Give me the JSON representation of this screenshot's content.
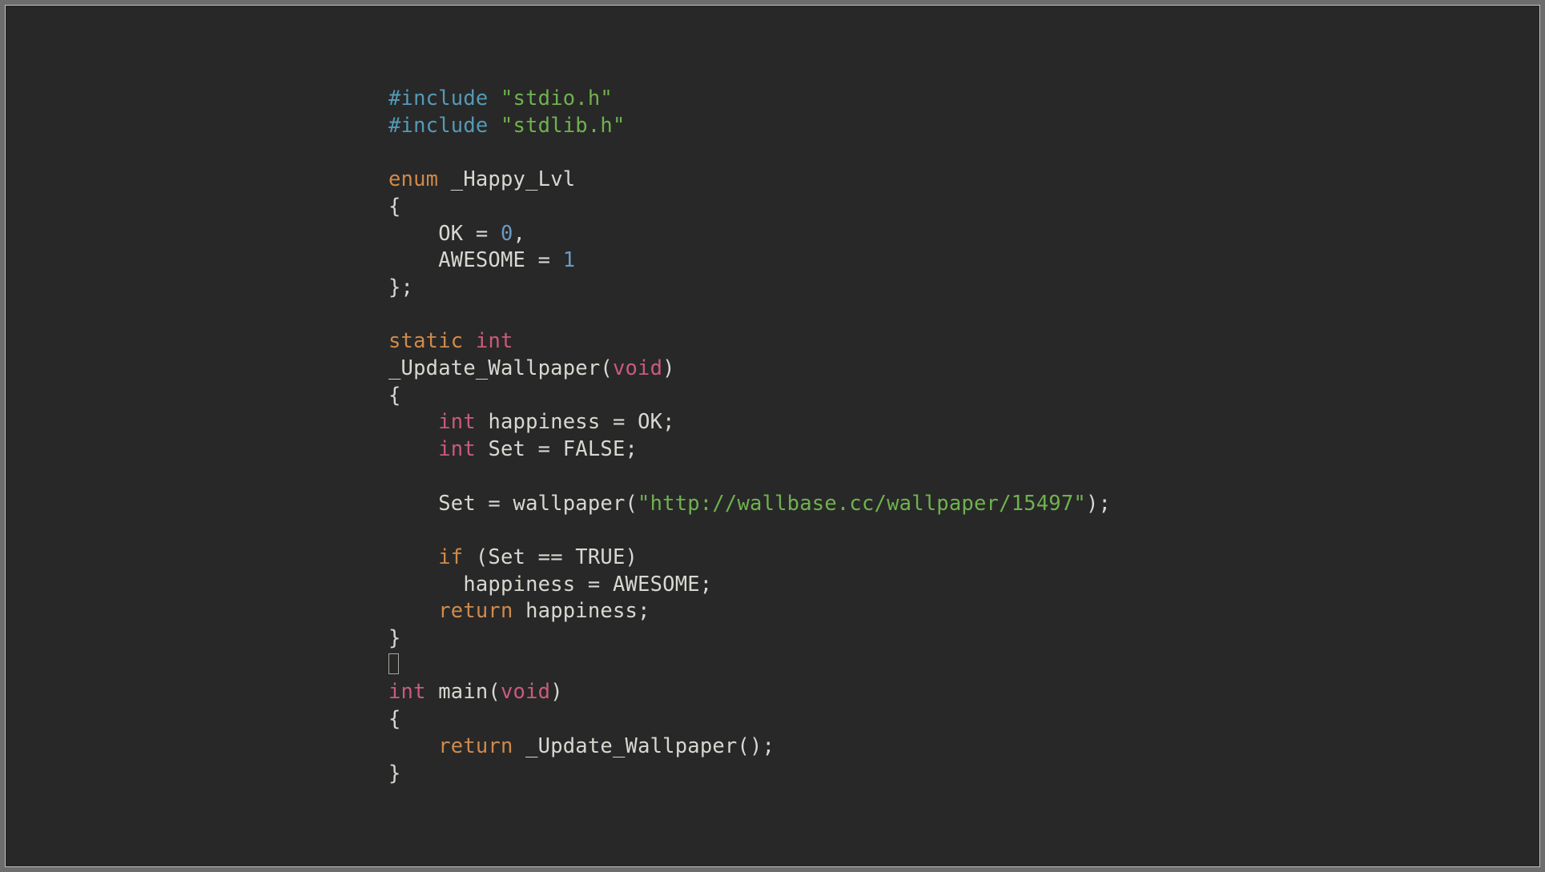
{
  "colors": {
    "background": "#282828",
    "frame_border": "#c0c0c0",
    "default_text": "#d8d8d2",
    "keyword": "#d08a4a",
    "preprocessor": "#549ab5",
    "string": "#6fb24e",
    "type": "#c95b7c",
    "number": "#6a9ac4"
  },
  "code": {
    "lines": [
      [
        {
          "class": "preproc",
          "text": "#include "
        },
        {
          "class": "string",
          "text": "\"stdio.h\""
        }
      ],
      [
        {
          "class": "preproc",
          "text": "#include "
        },
        {
          "class": "string",
          "text": "\"stdlib.h\""
        }
      ],
      [],
      [
        {
          "class": "keyword",
          "text": "enum"
        },
        {
          "class": "ident",
          "text": " _Happy_Lvl"
        }
      ],
      [
        {
          "class": "ident",
          "text": "{"
        }
      ],
      [
        {
          "class": "ident",
          "text": "    OK = "
        },
        {
          "class": "number",
          "text": "0"
        },
        {
          "class": "ident",
          "text": ","
        }
      ],
      [
        {
          "class": "ident",
          "text": "    AWESOME = "
        },
        {
          "class": "number",
          "text": "1"
        }
      ],
      [
        {
          "class": "ident",
          "text": "};"
        }
      ],
      [],
      [
        {
          "class": "keyword",
          "text": "static"
        },
        {
          "class": "ident",
          "text": " "
        },
        {
          "class": "type",
          "text": "int"
        }
      ],
      [
        {
          "class": "ident",
          "text": "_Update_Wallpaper("
        },
        {
          "class": "type",
          "text": "void"
        },
        {
          "class": "ident",
          "text": ")"
        }
      ],
      [
        {
          "class": "ident",
          "text": "{"
        }
      ],
      [
        {
          "class": "ident",
          "text": "    "
        },
        {
          "class": "type",
          "text": "int"
        },
        {
          "class": "ident",
          "text": " happiness = OK;"
        }
      ],
      [
        {
          "class": "ident",
          "text": "    "
        },
        {
          "class": "type",
          "text": "int"
        },
        {
          "class": "ident",
          "text": " Set = FALSE;"
        }
      ],
      [],
      [
        {
          "class": "ident",
          "text": "    Set = wallpaper("
        },
        {
          "class": "string",
          "text": "\"http://wallbase.cc/wallpaper/15497\""
        },
        {
          "class": "ident",
          "text": ");"
        }
      ],
      [],
      [
        {
          "class": "ident",
          "text": "    "
        },
        {
          "class": "keyword",
          "text": "if"
        },
        {
          "class": "ident",
          "text": " (Set == TRUE)"
        }
      ],
      [
        {
          "class": "ident",
          "text": "      happiness = AWESOME;"
        }
      ],
      [
        {
          "class": "ident",
          "text": "    "
        },
        {
          "class": "keyword",
          "text": "return"
        },
        {
          "class": "ident",
          "text": " happiness;"
        }
      ],
      [
        {
          "class": "ident",
          "text": "}"
        }
      ],
      [
        {
          "class": "cursor",
          "text": ""
        }
      ],
      [
        {
          "class": "type",
          "text": "int"
        },
        {
          "class": "ident",
          "text": " main("
        },
        {
          "class": "type",
          "text": "void"
        },
        {
          "class": "ident",
          "text": ")"
        }
      ],
      [
        {
          "class": "ident",
          "text": "{"
        }
      ],
      [
        {
          "class": "ident",
          "text": "    "
        },
        {
          "class": "keyword",
          "text": "return"
        },
        {
          "class": "ident",
          "text": " _Update_Wallpaper();"
        }
      ],
      [
        {
          "class": "ident",
          "text": "}"
        }
      ]
    ]
  }
}
